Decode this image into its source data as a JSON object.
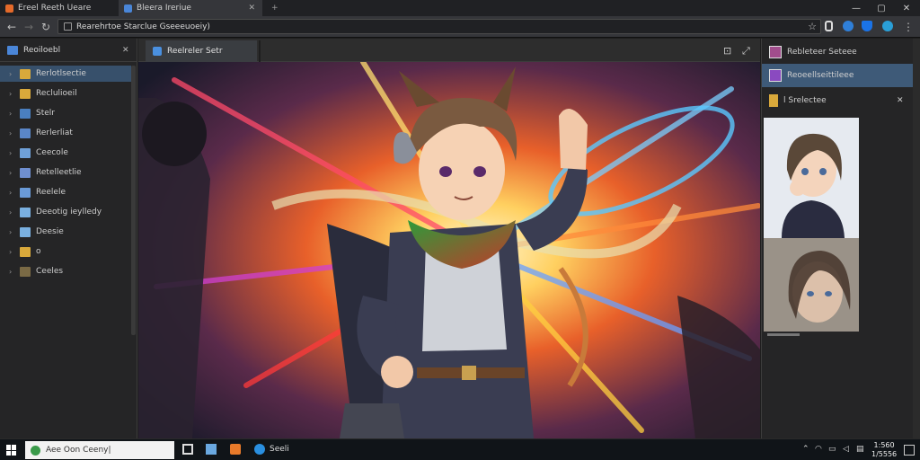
{
  "browser": {
    "tabs": [
      {
        "label": "Ereel Reeth Ueare",
        "active": false
      },
      {
        "label": "Bleera Ireriue",
        "active": true
      }
    ],
    "new_tab": "+",
    "window_controls": {
      "minimize": "—",
      "maximize": "▢",
      "close": "✕"
    },
    "address": "Rearehrtoe Starclue Gseeeuoeiy)"
  },
  "left_panel": {
    "title": "Reoiloebl",
    "close": "✕",
    "items": [
      {
        "label": "Rerlotlsectie",
        "icon": "folder-icon",
        "color": "#d9a93b",
        "selected": true
      },
      {
        "label": "Reclulioeil",
        "icon": "folder-icon",
        "color": "#d9a93b",
        "selected": false
      },
      {
        "label": "Stelr",
        "icon": "image-icon",
        "color": "#4a7fc0",
        "selected": false
      },
      {
        "label": "Rerlerliat",
        "icon": "cube-icon",
        "color": "#5a86c8",
        "selected": false
      },
      {
        "label": "Ceecole",
        "icon": "sheet-icon",
        "color": "#6fa0d8",
        "selected": false
      },
      {
        "label": "Retelleetlie",
        "icon": "doc-icon",
        "color": "#6f8fd0",
        "selected": false
      },
      {
        "label": "Reelele",
        "icon": "shield-icon",
        "color": "#6a9ad8",
        "selected": false
      },
      {
        "label": "Deeotig ieylledy",
        "icon": "monitor-icon",
        "color": "#7ab0e0",
        "selected": false
      },
      {
        "label": "Deesie",
        "icon": "monitor-icon",
        "color": "#7ab0e0",
        "selected": false
      },
      {
        "label": "o",
        "icon": "folder-icon",
        "color": "#d9a93b",
        "selected": false
      },
      {
        "label": "Ceeles",
        "icon": "folder-dark-icon",
        "color": "#7a6a45",
        "selected": false
      }
    ]
  },
  "editor": {
    "tab_label": "Reelreler Setr",
    "actions": [
      "⊡",
      "⤢"
    ]
  },
  "right_panel": {
    "items": [
      {
        "label": "Rebleteer Seteee",
        "selected": false
      },
      {
        "label": "Reoeellseittileee",
        "selected": true
      },
      {
        "label": "l Srelectee",
        "selected": false
      }
    ],
    "close": "✕"
  },
  "taskbar": {
    "search_text": "Aee Oon Ceeny|",
    "pinned_label": "Seeli",
    "time": "1:560",
    "date": "1/5556"
  }
}
